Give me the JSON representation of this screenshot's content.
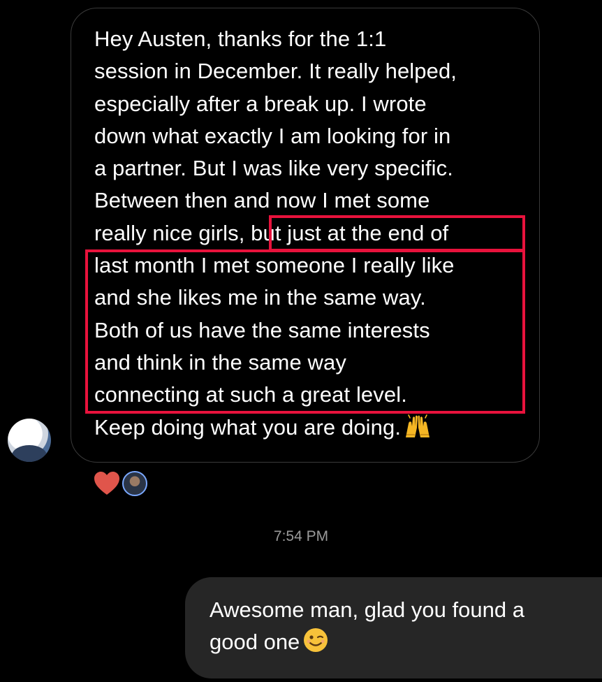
{
  "incoming": {
    "lines": [
      "Hey Austen, thanks for the 1:1",
      "session in December. It really helped,",
      "especially after a break up. I wrote",
      "down what exactly I am looking for in",
      "a partner. But I was like very specific.",
      "Between then and now I met some",
      "really nice girls, but just at the end of",
      "last month I met someone I really like",
      "and she likes me in the same way.",
      "Both of us have the same interests",
      "and think in the same way",
      "connecting at such a great level.",
      "Keep doing what you are doing."
    ],
    "emoji": "raising-hands-icon"
  },
  "reactions": {
    "icon": "heart-icon",
    "heart_color": "#e0554b"
  },
  "timestamp": "7:54 PM",
  "outgoing": {
    "lines": [
      "Awesome man, glad you found a",
      "good one"
    ],
    "emoji": "winking-face-icon"
  },
  "colors": {
    "background": "#000000",
    "outgoing_bubble": "#262626",
    "highlight": "#e8123c",
    "timestamp": "#9a9a9a"
  }
}
